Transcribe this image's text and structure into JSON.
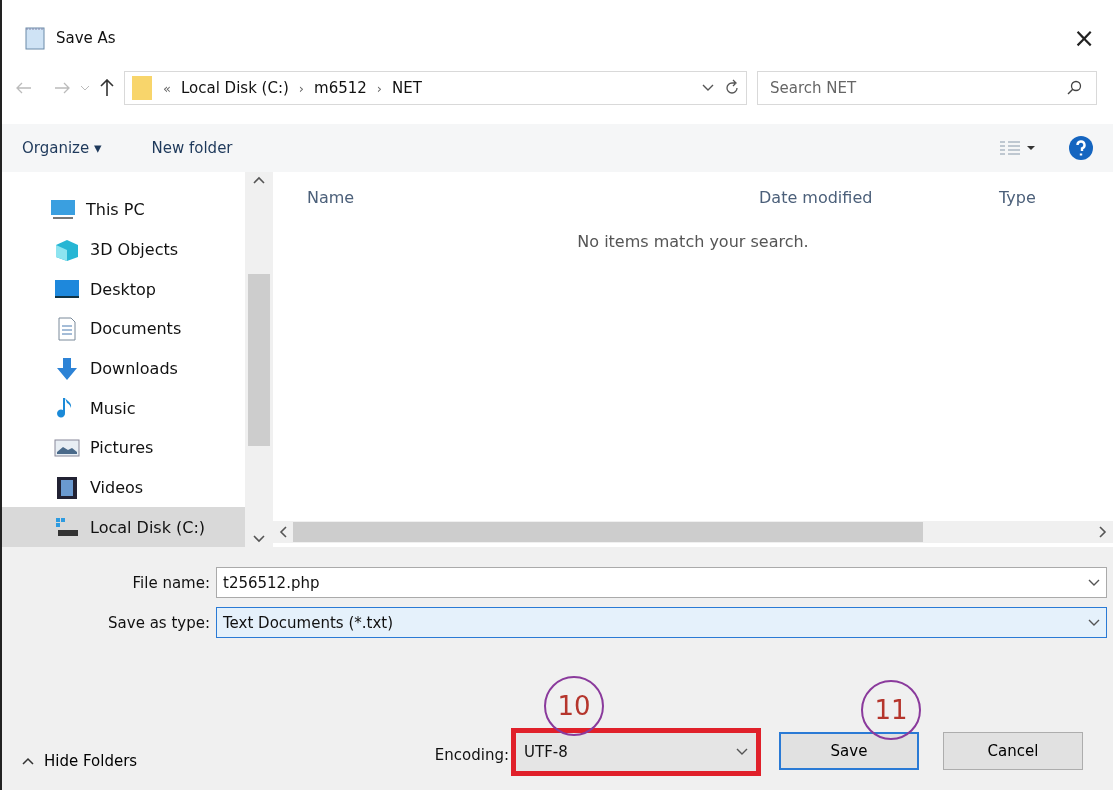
{
  "window": {
    "title": "Save As",
    "close": "×"
  },
  "address": {
    "parts": [
      "«",
      "Local Disk (C:)",
      "›",
      "m6512",
      "›",
      "NET"
    ]
  },
  "search": {
    "placeholder": "Search NET"
  },
  "toolbar": {
    "organize": "Organize ▾",
    "new_folder": "New folder"
  },
  "sidebar": {
    "items": [
      {
        "label": "This PC",
        "selected": false,
        "children": [
          {
            "label": "3D Objects",
            "selected": false
          },
          {
            "label": "Desktop",
            "selected": false
          },
          {
            "label": "Documents",
            "selected": false
          },
          {
            "label": "Downloads",
            "selected": false
          },
          {
            "label": "Music",
            "selected": false
          },
          {
            "label": "Pictures",
            "selected": false
          },
          {
            "label": "Videos",
            "selected": false
          },
          {
            "label": "Local Disk (C:)",
            "selected": true
          }
        ]
      }
    ]
  },
  "table": {
    "columns": [
      "Name",
      "Date modified",
      "Type"
    ],
    "empty": "No items match your search."
  },
  "form": {
    "file_name": {
      "label": "File name:",
      "value": "t256512.php"
    },
    "save_as_type": {
      "label": "Save as type:",
      "value": "Text Documents (*.txt)"
    }
  },
  "footer": {
    "hide_folders": "Hide Folders",
    "encoding_label": "Encoding:",
    "encoding": {
      "value": "UTF-8",
      "highlighted": true
    },
    "buttons": [
      {
        "label": "Save",
        "default": true
      },
      {
        "label": "Cancel",
        "default": false
      }
    ]
  },
  "annotations": [
    {
      "label": "10"
    },
    {
      "label": "11"
    }
  ]
}
